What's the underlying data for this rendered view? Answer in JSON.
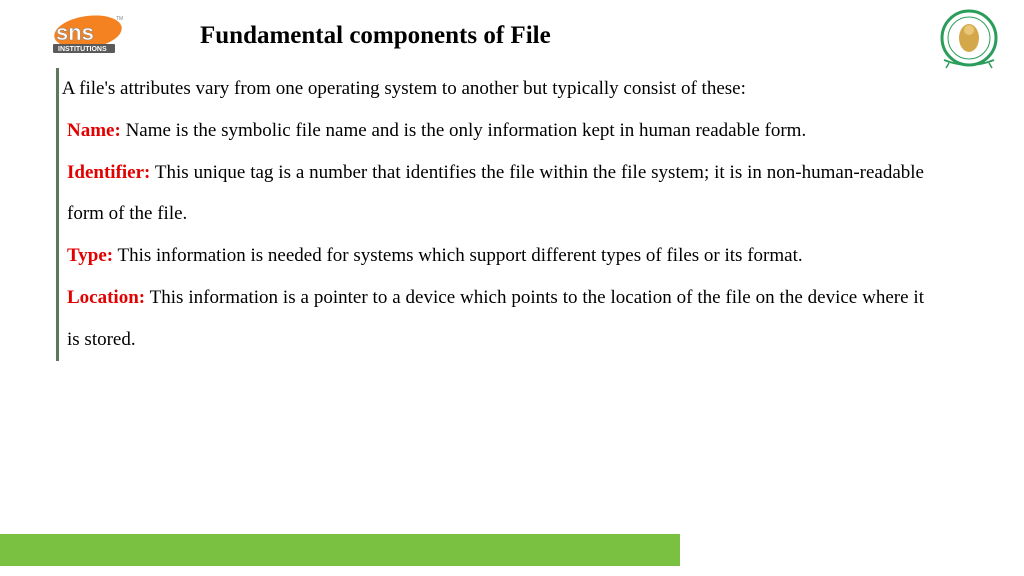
{
  "title": "Fundamental components of File",
  "intro": "A file's attributes vary from one operating system to another but typically consist of these:",
  "items": [
    {
      "term": "Name:",
      "desc": " Name is the symbolic file name and is the only information kept in human readable form."
    },
    {
      "term": "Identifier:",
      "desc": " This unique tag is a number that identifies the file within the file system; it is in non-human-readable form of the file."
    },
    {
      "term": "Type:",
      "desc": " This information is needed for systems which support different types of files or its format."
    },
    {
      "term": "Location:",
      "desc": " This information is a pointer to a device which points to the location of the file on the device where it is stored."
    }
  ],
  "logos": {
    "left_alt": "SNS Institutions",
    "right_alt": "College Emblem"
  }
}
